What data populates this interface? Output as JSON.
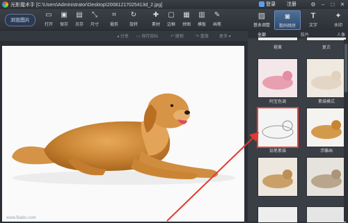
{
  "titlebar": {
    "app_title": "光影魔术手 [C:\\Users\\Administrator\\Desktop\\20081217025413d_2.jpg]",
    "user": "登录",
    "register": "注册"
  },
  "toolbar": {
    "open_label": "浏览图片",
    "tools": [
      {
        "label": "打开",
        "icon": "folder-icon"
      },
      {
        "label": "保存",
        "icon": "save-icon"
      },
      {
        "label": "另存",
        "icon": "save-as-icon"
      },
      {
        "label": "尺寸",
        "icon": "resize-icon"
      },
      {
        "label": "裁剪",
        "icon": "crop-icon"
      },
      {
        "label": "旋转",
        "icon": "rotate-icon"
      },
      {
        "label": "素材",
        "icon": "material-icon"
      },
      {
        "label": "边框",
        "icon": "border-icon"
      },
      {
        "label": "拼图",
        "icon": "collage-icon"
      },
      {
        "label": "模板",
        "icon": "template-icon"
      },
      {
        "label": "画笔",
        "icon": "brush-icon"
      }
    ]
  },
  "right_tabs": [
    {
      "label": "基本调整",
      "icon": "adjust-icon"
    },
    {
      "label": "数码暗房",
      "icon": "darkroom-icon"
    },
    {
      "label": "文字",
      "icon": "text-icon"
    },
    {
      "label": "水印",
      "icon": "watermark-icon"
    }
  ],
  "subbar": {
    "share": "分享",
    "save_as": "保存目标",
    "undo": "撤销",
    "redo": "重做",
    "more": "更多"
  },
  "panel": {
    "tabs": [
      "全部",
      "胶片",
      "人像"
    ],
    "effects_top": [
      "褪黄",
      "复古"
    ],
    "effects": [
      {
        "label": "阿宝色调"
      },
      {
        "label": "素描模式"
      },
      {
        "label": "铅笔素描"
      },
      {
        "label": "浮雕画"
      },
      {
        "label": ""
      },
      {
        "label": ""
      }
    ]
  },
  "watermark_text": "www.Baidu.com"
}
